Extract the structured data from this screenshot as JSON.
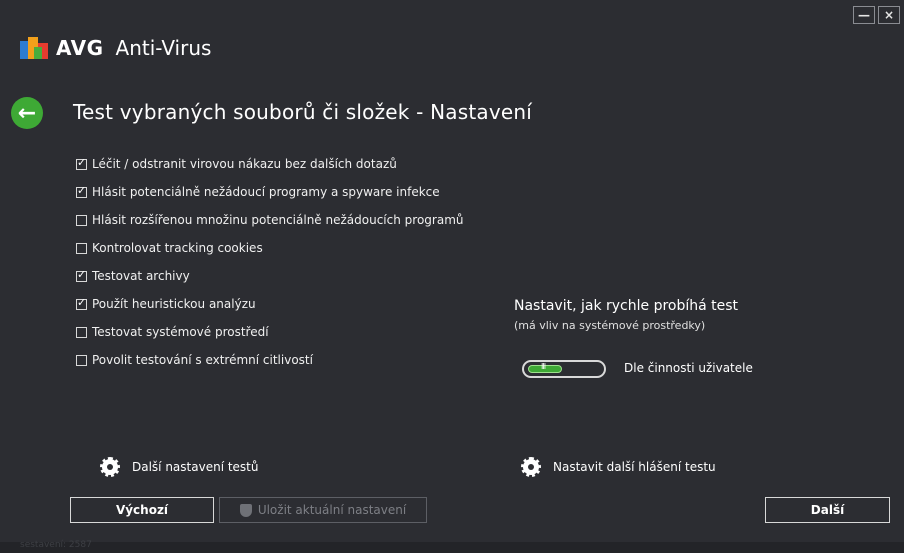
{
  "window": {
    "minimize_label": "—",
    "close_label": "×"
  },
  "brand": {
    "name": "AVG",
    "product": "Anti-Virus"
  },
  "page": {
    "back_icon": "←",
    "title": "Test vybraných souborů či složek - Nastavení"
  },
  "options": [
    {
      "label": "Léčit / odstranit virovou nákazu bez dalších dotazů",
      "checked": true
    },
    {
      "label": "Hlásit potenciálně nežádoucí programy a spyware infekce",
      "checked": true
    },
    {
      "label": "Hlásit rozšířenou množinu potenciálně nežádoucích programů",
      "checked": false
    },
    {
      "label": "Kontrolovat tracking cookies",
      "checked": false
    },
    {
      "label": "Testovat archivy",
      "checked": true
    },
    {
      "label": "Použít heuristickou analýzu",
      "checked": true
    },
    {
      "label": "Testovat systémové prostředí",
      "checked": false
    },
    {
      "label": "Povolit testování s extrémní citlivostí",
      "checked": false
    }
  ],
  "speed": {
    "title": "Nastavit, jak rychle probíhá test",
    "subtitle": "(má vliv na systémové prostředky)",
    "slider_grip": "III",
    "value_label": "Dle činnosti uživatele"
  },
  "links": {
    "more_settings": "Další nastavení testů",
    "report_settings": "Nastavit další hlášení testu"
  },
  "buttons": {
    "default": "Výchozí",
    "save": "Uložit aktuální nastavení",
    "next": "Další"
  },
  "footer": {
    "build": "sestavení: 2587"
  },
  "colors": {
    "accent_green": "#3ea935",
    "background": "#2c2d32"
  }
}
